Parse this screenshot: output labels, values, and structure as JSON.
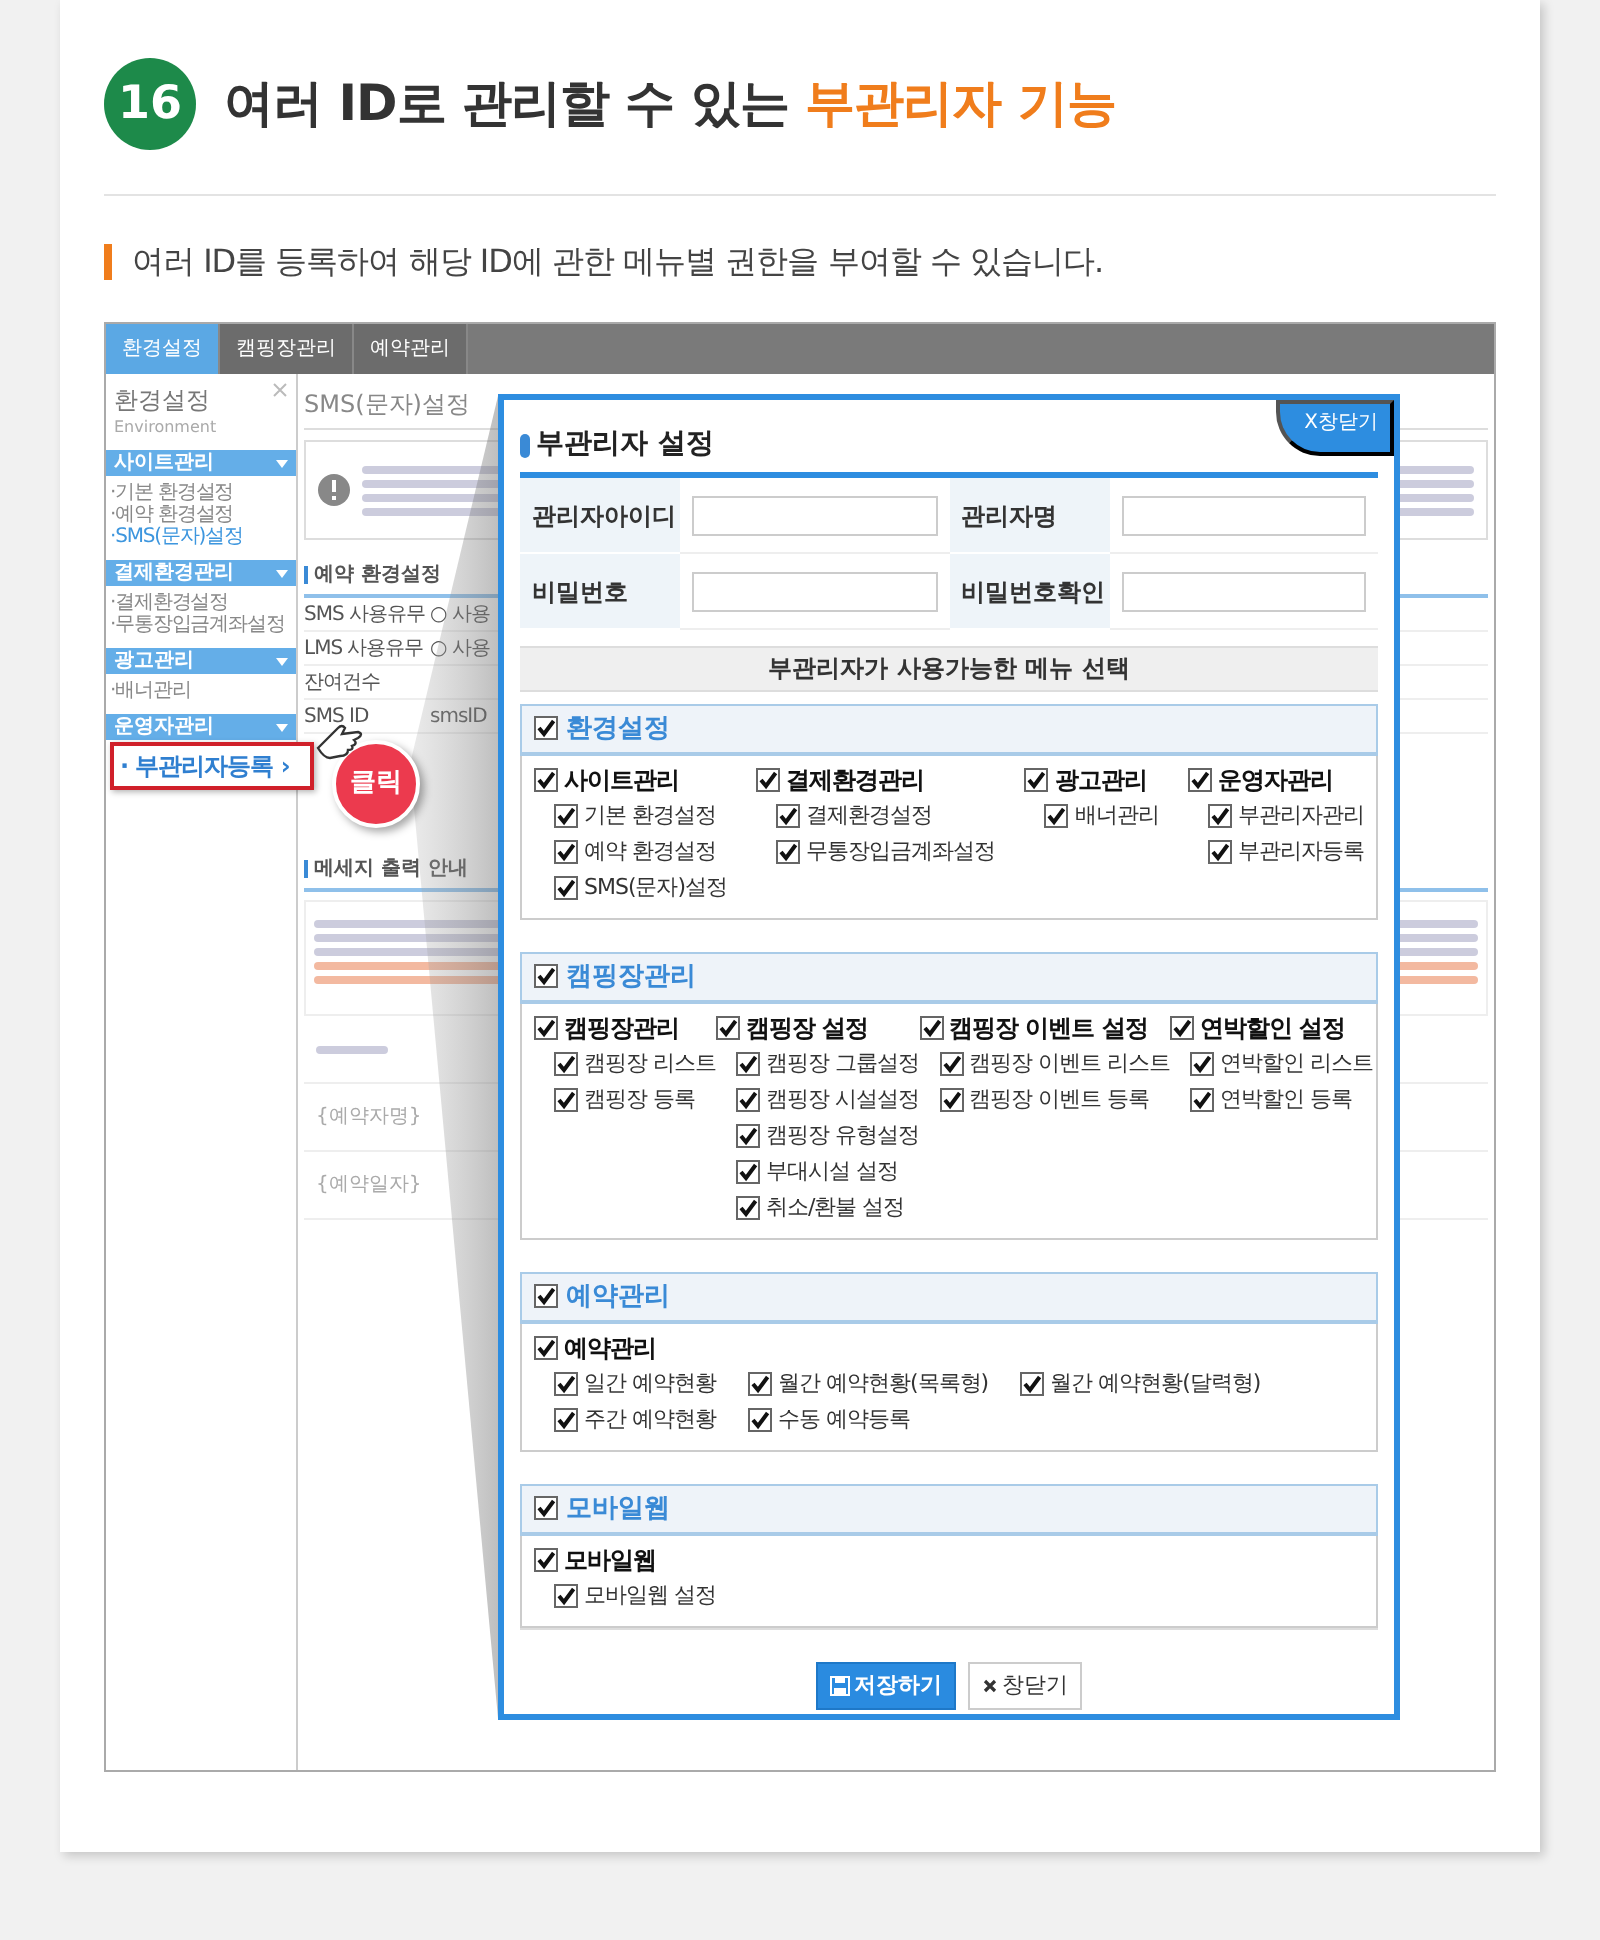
{
  "header": {
    "number": "16",
    "title": "여러 ID로 관리할 수 있는",
    "title_highlight": "부관리자 기능"
  },
  "subtitle": "여러 ID를 등록하여 해당 ID에 관한 메뉴별 권한을 부여할 수 있습니다.",
  "admin_screen": {
    "tabs": [
      {
        "label": "환경설정",
        "selected": true
      },
      {
        "label": "캠핑장관리",
        "selected": false
      },
      {
        "label": "예약관리",
        "selected": false
      }
    ],
    "sidebar": {
      "title": "환경설정",
      "subtitle": "Environment",
      "groups": [
        {
          "title": "사이트관리",
          "items": [
            {
              "label": "·기본 환경설정",
              "selected": false
            },
            {
              "label": "·예약 환경설정",
              "selected": false
            },
            {
              "label": "·SMS(문자)설정",
              "selected": true
            }
          ]
        },
        {
          "title": "결제환경관리",
          "items": [
            {
              "label": "·결제환경설정",
              "selected": false
            },
            {
              "label": "·무통장입금계좌설정",
              "selected": false
            }
          ]
        },
        {
          "title": "광고관리",
          "items": [
            {
              "label": "·배너관리",
              "selected": false
            }
          ]
        },
        {
          "title": "운영자관리"
        }
      ]
    },
    "content": {
      "title": "SMS(문자)설정",
      "section": "예약 환경설정",
      "rows": [
        {
          "label": "SMS 사용유무",
          "value": "○ 사용"
        },
        {
          "label": "LMS 사용유무",
          "value": "○ 사용"
        },
        {
          "label": "잔여건수"
        },
        {
          "label": "SMS ID",
          "value": "smsID"
        }
      ],
      "notice_title": "메세지 출력 안내",
      "fields": [
        "{예약자명}",
        "{예약일자}"
      ]
    },
    "callout": {
      "label": "· 부관리자등록 ›",
      "badge": "클릭"
    }
  },
  "popup": {
    "close_tab": "X창닫기",
    "title": "부관리자 설정",
    "fields": [
      {
        "label": "관리자아이디"
      },
      {
        "label": "관리자명"
      },
      {
        "label": "비밀번호"
      },
      {
        "label": "비밀번호확인"
      }
    ],
    "menu_heading": "부관리자가 사용가능한 메뉴 선택",
    "groups": [
      {
        "label": "환경설정",
        "checked": true,
        "columns": [
          {
            "label": "사이트관리",
            "checked": true,
            "kind": "list",
            "children": [
              {
                "label": "기본 환경설정",
                "checked": true
              },
              {
                "label": "예약 환경설정",
                "checked": true
              },
              {
                "label": "SMS(문자)설정",
                "checked": true
              }
            ]
          },
          {
            "label": "결제환경관리",
            "checked": true,
            "kind": "list",
            "children": [
              {
                "label": "결제환경설정",
                "checked": true
              },
              {
                "label": "무통장입금계좌설정",
                "checked": true
              }
            ]
          },
          {
            "label": "광고관리",
            "checked": true,
            "kind": "list",
            "children": [
              {
                "label": "배너관리",
                "checked": true
              }
            ]
          },
          {
            "label": "운영자관리",
            "checked": true,
            "kind": "list",
            "children": [
              {
                "label": "부관리자관리",
                "checked": true
              },
              {
                "label": "부관리자등록",
                "checked": true
              }
            ]
          }
        ]
      },
      {
        "label": "캠핑장관리",
        "checked": true,
        "columns": [
          {
            "label": "캠핑장관리",
            "checked": true,
            "kind": "list",
            "children": [
              {
                "label": "캠핑장 리스트",
                "checked": true
              },
              {
                "label": "캠핑장 등록",
                "checked": true
              }
            ]
          },
          {
            "label": "캠핑장 설정",
            "checked": true,
            "kind": "list",
            "children": [
              {
                "label": "캠핑장 그룹설정",
                "checked": true
              },
              {
                "label": "캠핑장 시설설정",
                "checked": true
              },
              {
                "label": "캠핑장 유형설정",
                "checked": true
              },
              {
                "label": "부대시설 설정",
                "checked": true
              },
              {
                "label": "취소/환불 설정",
                "checked": true
              }
            ]
          },
          {
            "label": "캠핑장 이벤트 설정",
            "checked": true,
            "kind": "list",
            "children": [
              {
                "label": "캠핑장 이벤트 리스트",
                "checked": true
              },
              {
                "label": "캠핑장 이벤트 등록",
                "checked": true
              }
            ]
          },
          {
            "label": "연박할인 설정",
            "checked": true,
            "kind": "list",
            "children": [
              {
                "label": "연박할인 리스트",
                "checked": true
              },
              {
                "label": "연박할인 등록",
                "checked": true
              }
            ]
          }
        ]
      },
      {
        "label": "예약관리",
        "checked": true,
        "columns": [
          {
            "label": "예약관리",
            "checked": true,
            "kind": "grid",
            "children": [
              {
                "label": "일간 예약현황",
                "checked": true
              },
              {
                "label": "주간 예약현황",
                "checked": true
              },
              {
                "label": "월간 예약현황(목록형)",
                "checked": true
              },
              {
                "label": "수동 예약등록",
                "checked": true
              },
              {
                "label": "월간 예약현황(달력형)",
                "checked": true
              }
            ]
          }
        ]
      },
      {
        "label": "모바일웹",
        "checked": true,
        "columns": [
          {
            "label": "모바일웹",
            "checked": true,
            "kind": "list",
            "children": [
              {
                "label": "모바일웹 설정",
                "checked": true
              }
            ]
          }
        ]
      }
    ],
    "buttons": [
      {
        "label": "저장하기",
        "kind": "primary"
      },
      {
        "label": "창닫기",
        "kind": "secondary"
      }
    ]
  }
}
